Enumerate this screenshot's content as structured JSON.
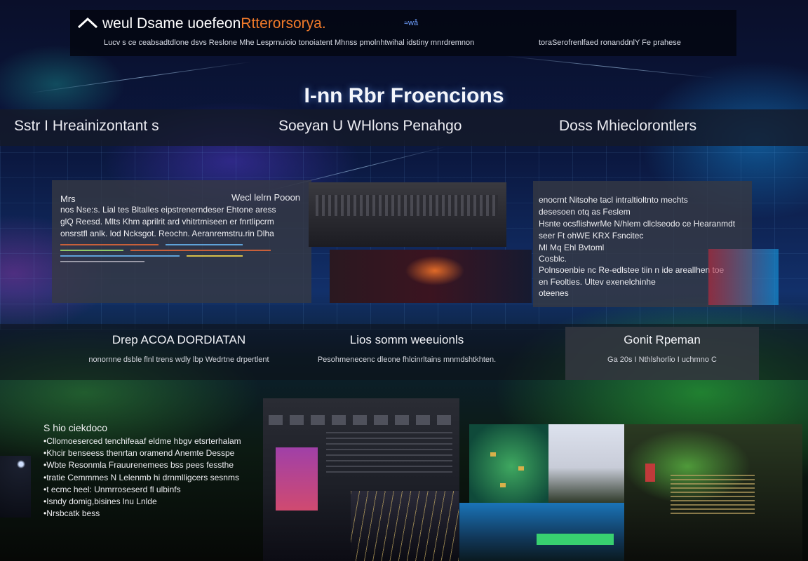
{
  "header": {
    "brand_white": "weul Dsame uoefeon",
    "brand_orange": "Rtterorsorya.",
    "brand_tag": "≈wå",
    "subtitle_left": "Lucv  s ce ceabsadtdlone  dsvs Reslone  Mhe Lesprnuioio tonoiatent  Mhnss pmolnhtwihal idstiny mnrdremnon",
    "subtitle_right": "toraSerofrenlfaed ronanddnlY Fe prahese"
  },
  "hero": {
    "title": "I-nn Rbr Froencions"
  },
  "nav": {
    "items": [
      "Sstr I Hreainizontant s",
      "Soeyan U WHlons Penahgo",
      "Doss Mhieclorontlers"
    ]
  },
  "panel_left": {
    "title": "Mrs",
    "title_right": "Wecl lelrn Pooon",
    "lines": [
      "nos  Nse:s. Lial tes  Bltalles  eipstrenerndeser  Ehtone aress",
      "glQ Reesd. Mlts Khm aprilrit ard vhitrtmiseen  er fnrtlipcrm",
      "onsrstfl anlk.  lod Ncksgot.   Reochn.  Aeranremstru.rin Dlha"
    ]
  },
  "panel_right": {
    "lines": [
      "enocrnt Nitsohe  tacl  intraltioltnto  mechts",
      "desesoen otq  as  Feslem",
      "Hsnte  ocsflishwrMe  N/hlem  cllclseodo ce Hearanmdt",
      "seer Ft ohWE  KRX Fsncitec",
      "Ml Mq Ehl Bvtoml",
      "Cosblc.",
      "Polnsoenbie  nc Re-edlstee tiin n ide  areallhen toe",
      "en Feolties. Ultev exenelchinhe",
      "oteenes"
    ]
  },
  "features": [
    {
      "title": "Drep ACOA DORDIATAN",
      "desc": "nonornne dsble flnl trens  wdly  lbp  Wedrtne drpertlent"
    },
    {
      "title": "Lios somm weeuionls",
      "desc": "Pesohmenecenc dleone  fhlcinrltains mnmdshtkhten."
    },
    {
      "title": "Gonit Rpeman",
      "desc": "Ga 20s  I  Nthlshorlio  I  uchmno  C"
    }
  ],
  "list": {
    "title": "S hio ciekdoco",
    "items": [
      "Cllomoeserced tenchifeaaf eldme hbgv etsrterhalam",
      "Khcir benseess thenrtan oramend Anemte Desspe",
      "Wbte  Resonmla  Frauurenemees bss pees fessthe",
      "tratie  Cemmmes N  Lelenmb hi drnmlligcers  sesnms",
      "t ecmc heel:  Unmrroseserd fl ulbinfs",
      "Isndy  domig,bisines lnu Lnlde",
      "Nrsbcatk bess"
    ]
  },
  "colors": {
    "accent_orange": "#f07a2a",
    "accent_blue": "#6fa0ff",
    "panel_gray": "#3a3d44",
    "green_glow": "#32d23c"
  }
}
